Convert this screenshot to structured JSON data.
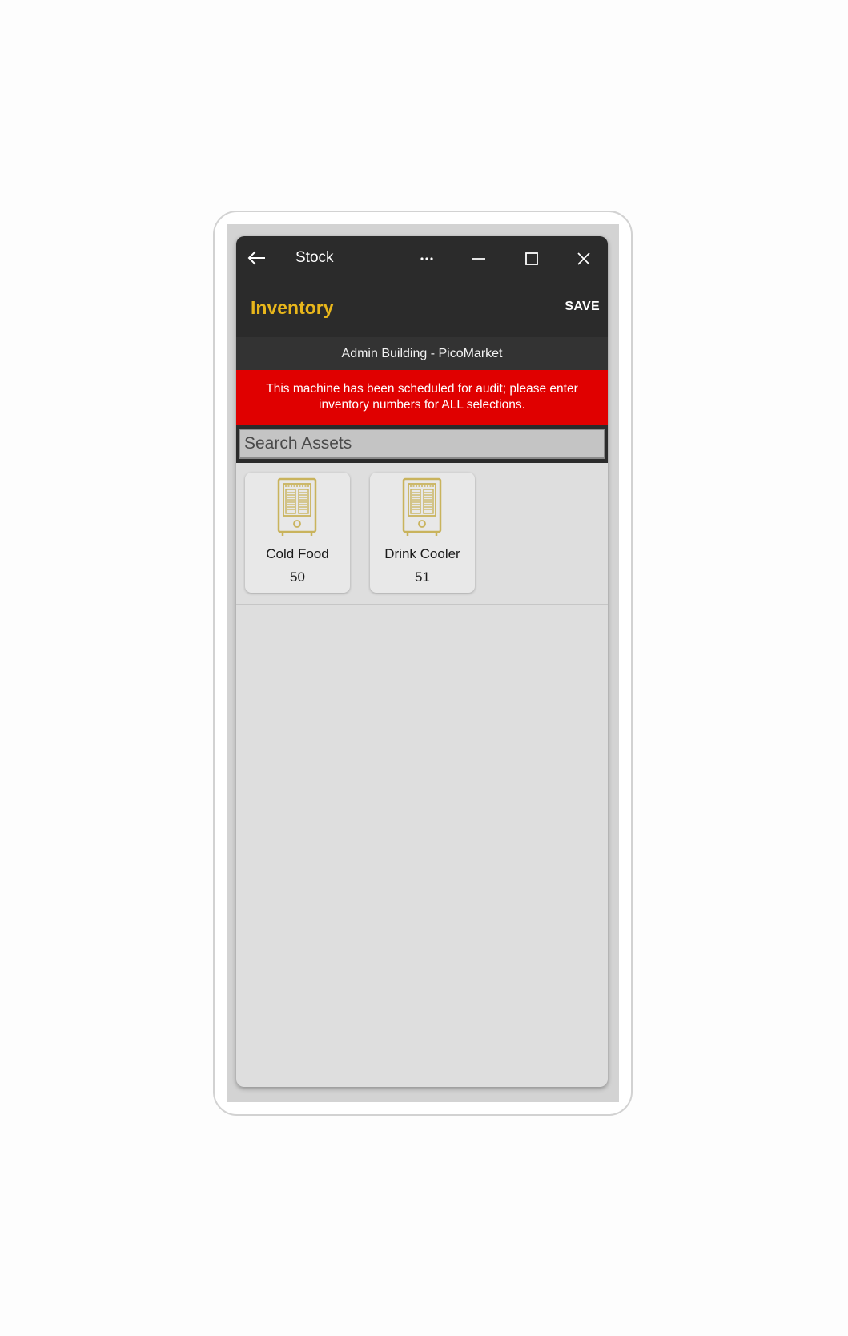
{
  "window": {
    "title": "Stock",
    "icons": {
      "back": "back-arrow-icon",
      "more": "more-icon",
      "minimize": "minimize-icon",
      "maximize": "maximize-icon",
      "close": "close-icon"
    }
  },
  "header": {
    "title": "Inventory",
    "save_label": "SAVE",
    "title_color": "#e8b61b"
  },
  "location": {
    "label": "Admin Building - PicoMarket"
  },
  "audit_banner": {
    "line1": "This machine has been scheduled for audit; please enter",
    "line2": "inventory numbers for ALL selections.",
    "color": "#e00000"
  },
  "search": {
    "placeholder": "Search Assets",
    "value": ""
  },
  "assets": [
    {
      "name": "Cold Food",
      "count": "50",
      "icon": "vending-machine-icon"
    },
    {
      "name": "Drink Cooler",
      "count": "51",
      "icon": "vending-machine-icon"
    }
  ],
  "colors": {
    "title_bar": "#2b2b2b",
    "accent": "#e8b61b",
    "icon_gold": "#c9b35c",
    "content_bg": "#dedede"
  }
}
